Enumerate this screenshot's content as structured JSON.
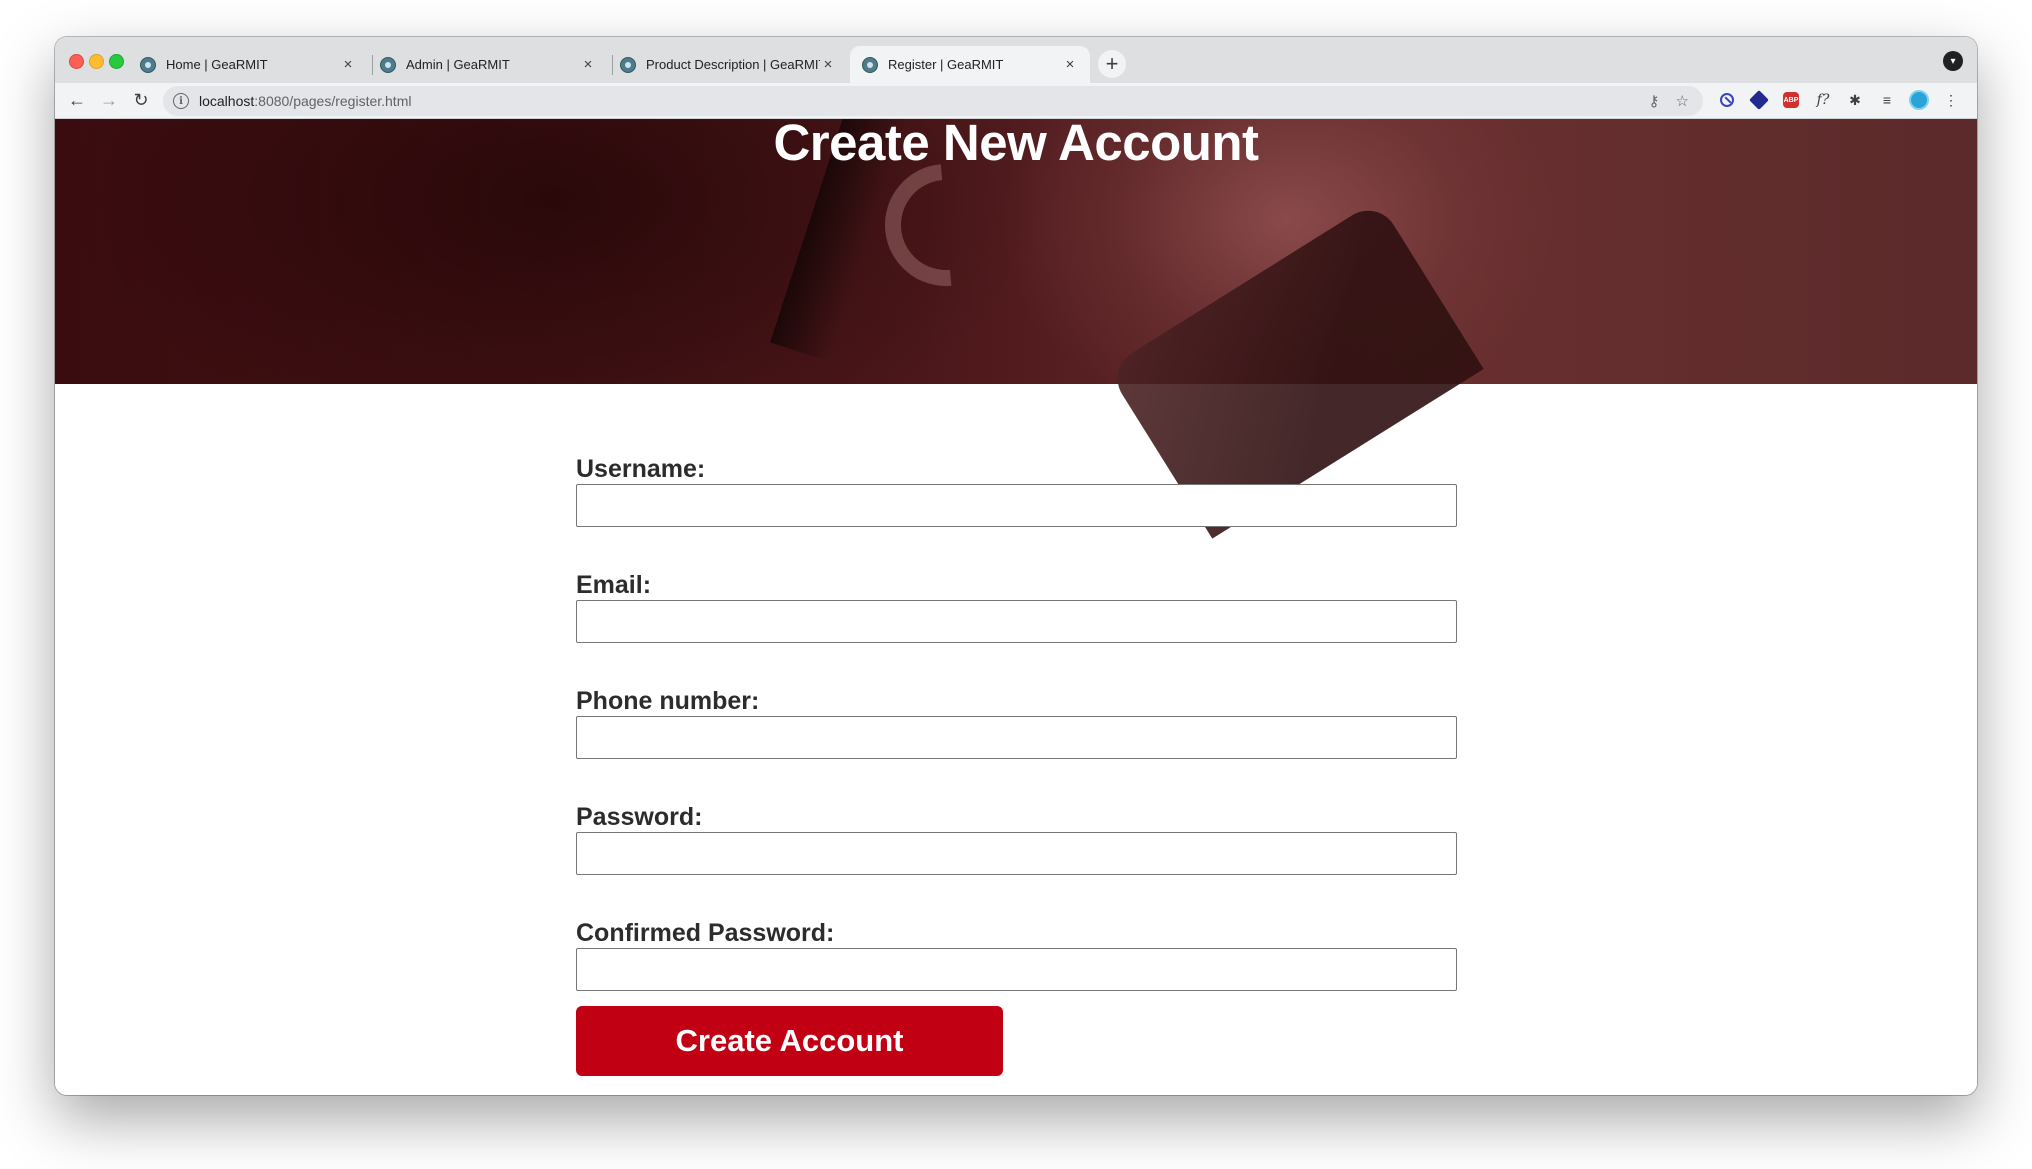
{
  "browser": {
    "tabs": [
      {
        "title": "Home | GeaRMIT",
        "active": false
      },
      {
        "title": "Admin | GeaRMIT",
        "active": false
      },
      {
        "title": "Product Description | GeaRMIT",
        "active": false
      },
      {
        "title": "Register | GeaRMIT",
        "active": true
      }
    ],
    "tab_close_glyph": "×",
    "new_tab_glyph": "+",
    "url_host": "localhost",
    "url_path": ":8080/pages/register.html"
  },
  "page": {
    "heading": "Create New Account",
    "fields": [
      {
        "label": "Username:",
        "value": ""
      },
      {
        "label": "Email:",
        "value": ""
      },
      {
        "label": "Phone number:",
        "value": ""
      },
      {
        "label": "Password:",
        "value": ""
      },
      {
        "label": "Confirmed Password:",
        "value": ""
      }
    ],
    "submit_label": "Create Account",
    "accent_color": "#c20013",
    "hero_color": "#4c171a"
  }
}
